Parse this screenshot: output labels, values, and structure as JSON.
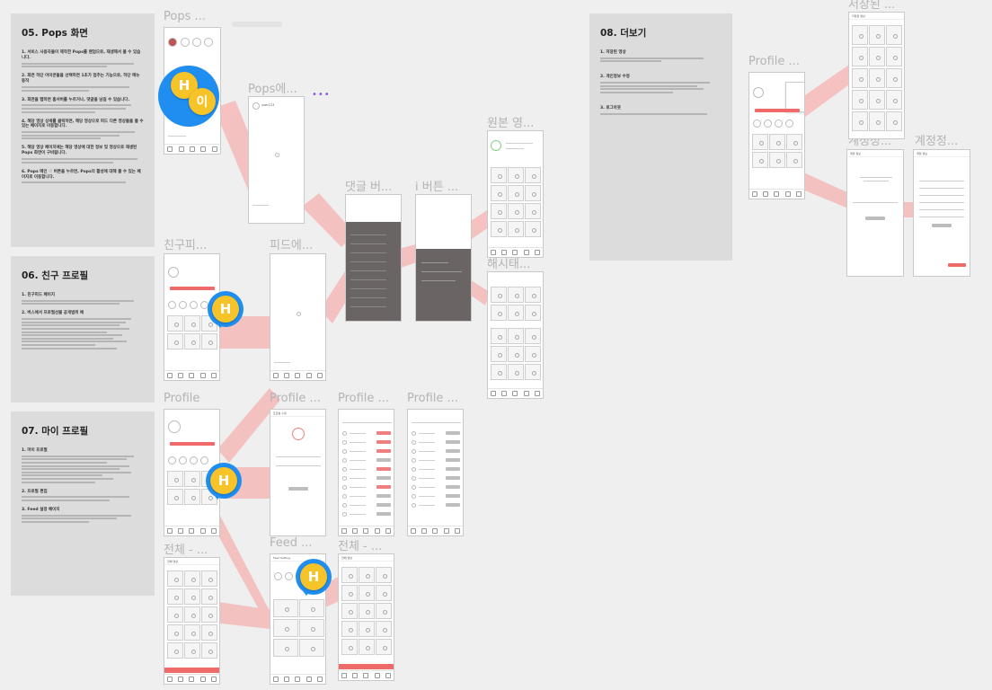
{
  "docs": [
    {
      "title": "05. Pops 화면",
      "sections": [
        "1. 서비스 사용자들이 제작한 Pops를 랜덤으로, 재생해서 볼 수 있습니다.",
        "2. 화면 하단 아이콘들을 선택하면 1초가 멈추는 기능으로, 하단 메뉴 동작",
        "3. 화면을 탭하면 홈서버를 누르거나, 댓글을 남길 수 있습니다.",
        "4. 해당 영상 상세를 클릭하면, 해당 영상으로 피드 다른 영상들을 볼 수 있는 페이지로 이동합니다.",
        "5. 해당 영상 페이지에는 해당 영상에 대한 정보 및 영상으로 재생된 Pops 화면이 구비됩니다.",
        "6. Pops 메인 ♡ 버튼을 누르면, Pops의 활성에 대해 볼 수 있는 페이지로 이동합니다."
      ]
    },
    {
      "title": "06. 친구 프로필",
      "sections": [
        "1. 친구피드 페이지",
        "2. 버스에서 프로필선물 공개범위 예"
      ]
    },
    {
      "title": "07. 마이 프로필",
      "sections": [
        "1. 마이 프로필",
        "2. 프로필 편집",
        "3. Feed 설정 페이지"
      ]
    },
    {
      "title": "08. 더보기",
      "sections": [
        "1. 저장된 영상",
        "2. 개인정보 수정",
        "3. 로그아웃"
      ]
    }
  ],
  "frame_labels": {
    "pops": "Pops ...",
    "pops_e": "Pops에...",
    "comment_btn": "댓글 버...",
    "i_btn": "i 버튼 ...",
    "original": "원본 영...",
    "hashtag": "해시태...",
    "friend_p": "친구피...",
    "feed_e": "피드에...",
    "profile_main": "Profile",
    "profile_2": "Profile ...",
    "profile_3": "Profile ...",
    "profile_4": "Profile ...",
    "all_1": "전체 - ...",
    "feed_dots": "Feed ...",
    "all_2": "전체 - ...",
    "profile_more": "Profile ...",
    "saved": "저장된 ...",
    "account_1": "계정정...",
    "account_2": "계정정..."
  },
  "frame_text": {
    "user_id": "user123",
    "saved_header": "저장된 영상",
    "account_header": "계정 정보",
    "profile_edit_header": "프로필 수정",
    "all_header": "전체 영상",
    "feed_setting": "Feed Setting",
    "logout": "로그아웃"
  },
  "cursors": [
    {
      "initial": "H"
    },
    {
      "initial": "이"
    },
    {
      "initial": "H"
    },
    {
      "initial": "H"
    },
    {
      "initial": "H"
    }
  ],
  "colors": {
    "flow": "#f6b9b9",
    "accent": "#f06a6a",
    "cursor": "#f6c329",
    "ring": "#1f8ef0"
  }
}
